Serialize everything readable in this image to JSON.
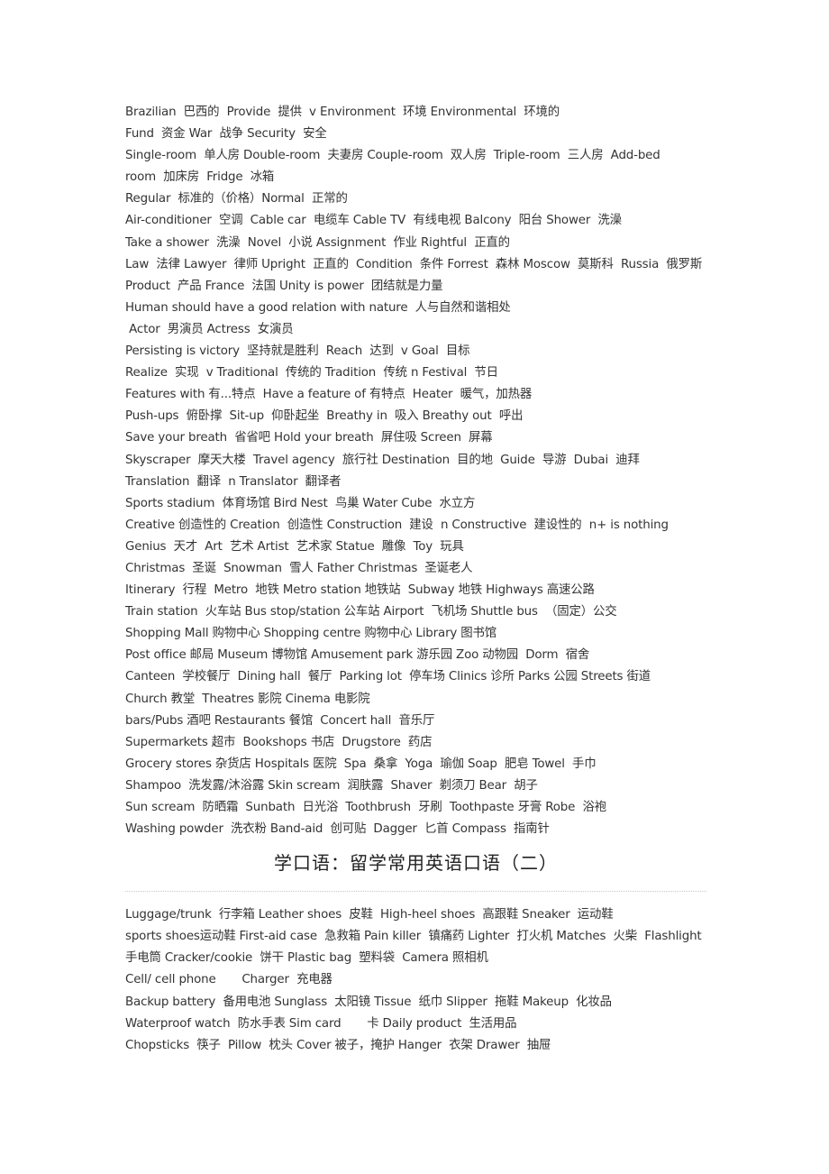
{
  "section1": {
    "lines": [
      "Brazilian  巴西的  Provide  提供  v Environment  环境 Environmental  环境的",
      "Fund  资金 War  战争 Security  安全",
      "Single-room  单人房 Double-room  夫妻房 Couple-room  双人房  Triple-room  三人房  Add-bed",
      "room  加床房  Fridge  冰箱",
      "Regular  标准的（价格）Normal  正常的",
      "Air-conditioner  空调  Cable car  电缆车 Cable TV  有线电视 Balcony  阳台 Shower  洗澡",
      "Take a shower  洗澡  Novel  小说 Assignment  作业 Rightful  正直的",
      "Law  法律 Lawyer  律师 Upright  正直的  Condition  条件 Forrest  森林 Moscow  莫斯科  Russia  俄罗斯",
      "Product  产品 France  法国 Unity is power  团结就是力量",
      "Human should have a good relation with nature  人与自然和谐相处",
      " Actor  男演员 Actress  女演员",
      "Persisting is victory  坚持就是胜利  Reach  达到  v Goal  目标",
      "Realize  实现  v Traditional  传统的 Tradition  传统 n Festival  节日",
      "Features with 有...特点  Have a feature of 有特点  Heater  暖气，加热器",
      "Push-ups  俯卧撑  Sit-up  仰卧起坐  Breathy in  吸入 Breathy out  呼出",
      "Save your breath  省省吧 Hold your breath  屏住吸 Screen  屏幕",
      "Skyscraper  摩天大楼  Travel agency  旅行社 Destination  目的地  Guide  导游  Dubai  迪拜",
      "Translation  翻译  n Translator  翻译者",
      "Sports stadium  体育场馆 Bird Nest  鸟巢 Water Cube  水立方",
      "Creative 创造性的 Creation  创造性 Construction  建设  n Constructive  建设性的  n+ is nothing",
      "Genius  天才  Art  艺术 Artist  艺术家 Statue  雕像  Toy  玩具",
      "Christmas  圣诞  Snowman  雪人 Father Christmas  圣诞老人",
      "Itinerary  行程  Metro  地铁 Metro station 地铁站  Subway 地铁 Highways 高速公路",
      "Train station  火车站 Bus stop/station 公车站 Airport  飞机场 Shuttle bus  （固定）公交",
      "Shopping Mall 购物中心 Shopping centre 购物中心 Library 图书馆",
      "Post office 邮局 Museum 博物馆 Amusement park 游乐园 Zoo 动物园  Dorm  宿舍",
      "Canteen  学校餐厅  Dining hall  餐厅  Parking lot  停车场 Clinics 诊所 Parks 公园 Streets 街道",
      "Church 教堂  Theatres 影院 Cinema 电影院",
      "bars/Pubs 酒吧 Restaurants 餐馆  Concert hall  音乐厅",
      "Supermarkets 超市  Bookshops 书店  Drugstore  药店",
      "Grocery stores 杂货店 Hospitals 医院  Spa  桑拿  Yoga  瑜伽 Soap  肥皂 Towel  手巾",
      "Shampoo  洗发露/沐浴露 Skin scream  润肤露  Shaver  剃须刀 Bear  胡子",
      "Sun scream  防晒霜  Sunbath  日光浴  Toothbrush  牙刷  Toothpaste 牙膏 Robe  浴袍",
      "Washing powder  洗衣粉 Band-aid  创可贴  Dagger  匕首 Compass  指南针"
    ]
  },
  "section2": {
    "title": "学口语：留学常用英语口语（二）",
    "lines": [
      "Luggage/trunk  行李箱 Leather shoes  皮鞋  High-heel shoes  高跟鞋 Sneaker  运动鞋",
      "sports shoes运动鞋 First-aid case  急救箱 Pain killer  镇痛药 Lighter  打火机 Matches  火柴  Flashlight",
      "手电筒 Cracker/cookie  饼干 Plastic bag  塑料袋  Camera 照相机",
      "Cell/ cell phone       Charger  充电器",
      "Backup battery  备用电池 Sunglass  太阳镜 Tissue  纸巾 Slipper  拖鞋 Makeup  化妆品",
      "Waterproof watch  防水手表 Sim card       卡 Daily product  生活用品",
      "Chopsticks  筷子  Pillow  枕头 Cover 被子，掩护 Hanger  衣架 Drawer  抽屉"
    ]
  }
}
